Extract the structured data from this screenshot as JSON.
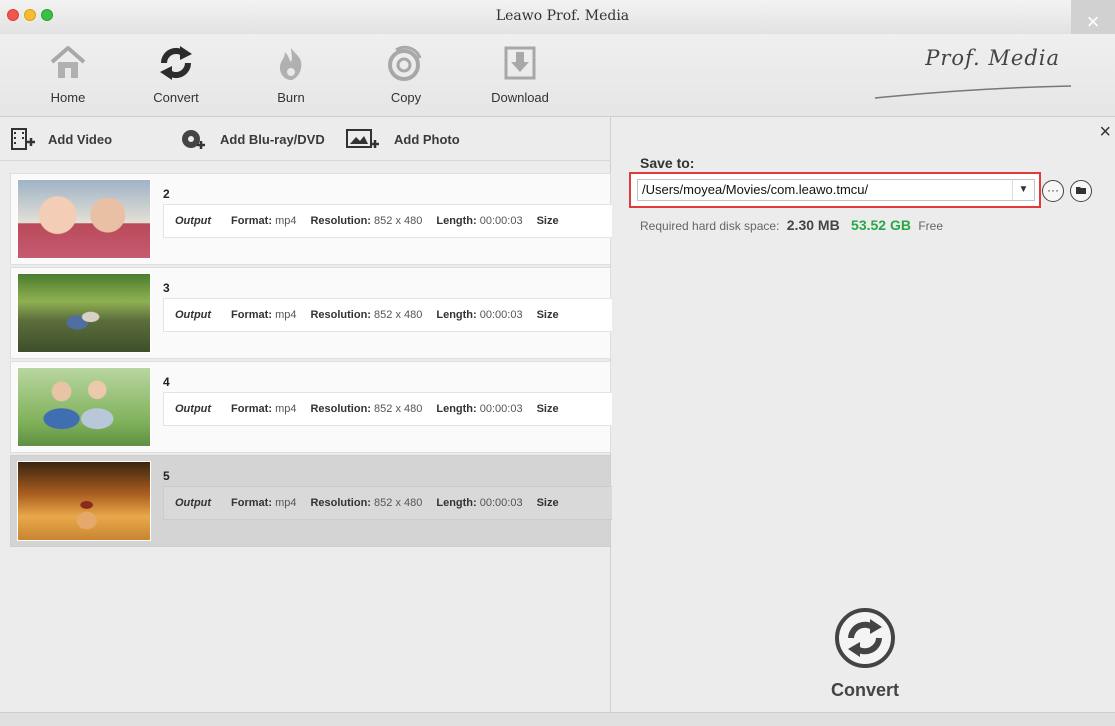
{
  "window": {
    "title": "Leawo Prof. Media",
    "close_glyph": "×"
  },
  "toolbar": {
    "items": [
      {
        "label": "Home",
        "icon": "home-icon"
      },
      {
        "label": "Convert",
        "icon": "convert-icon"
      },
      {
        "label": "Burn",
        "icon": "burn-icon"
      },
      {
        "label": "Copy",
        "icon": "copy-icon"
      },
      {
        "label": "Download",
        "icon": "download-icon"
      }
    ],
    "brand": "Prof. Media"
  },
  "addbar": {
    "add_video": "Add Video",
    "add_bluray": "Add Blu-ray/DVD",
    "add_photo": "Add Photo"
  },
  "labels": {
    "output": "Output",
    "format": "Format:",
    "resolution": "Resolution:",
    "length": "Length:",
    "size": "Size"
  },
  "items": [
    {
      "number": "2",
      "format": "mp4",
      "resolution": "852 x 480",
      "length": "00:00:03"
    },
    {
      "number": "3",
      "format": "mp4",
      "resolution": "852 x 480",
      "length": "00:00:03"
    },
    {
      "number": "4",
      "format": "mp4",
      "resolution": "852 x 480",
      "length": "00:00:03"
    },
    {
      "number": "5",
      "format": "mp4",
      "resolution": "852 x 480",
      "length": "00:00:03",
      "selected": true
    }
  ],
  "settings": {
    "close_glyph": "×",
    "save_to_label": "Save to:",
    "path": "/Users/moyea/Movies/com.leawo.tmcu/",
    "disk_label": "Required hard disk space:",
    "required": "2.30 MB",
    "free": "53.52 GB",
    "free_label": "Free",
    "convert_label": "Convert",
    "colors": {
      "highlight_border": "#e03a3a",
      "free_space": "#27a844"
    }
  }
}
